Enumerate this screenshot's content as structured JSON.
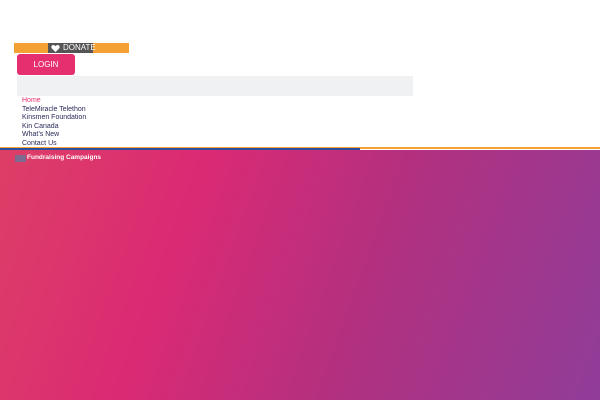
{
  "header": {
    "donate_label": "DONATE",
    "login_label": "LOGIN"
  },
  "nav": {
    "items": [
      {
        "label": "Home"
      },
      {
        "label": "TeleMiracle Telethon"
      },
      {
        "label": "Kinsmen Foundation"
      },
      {
        "label": "Kin Canada"
      },
      {
        "label": "What’s New"
      },
      {
        "label": "Contact Us"
      }
    ]
  },
  "hero": {
    "tab_label": "Fundraising Campaigns"
  },
  "colors": {
    "accent_pink": "#e62f6f",
    "donate_orange": "#f5a033",
    "rule_blue": "#2d4f9e",
    "gradient_start": "#dc3f66",
    "gradient_end": "#903d99"
  }
}
